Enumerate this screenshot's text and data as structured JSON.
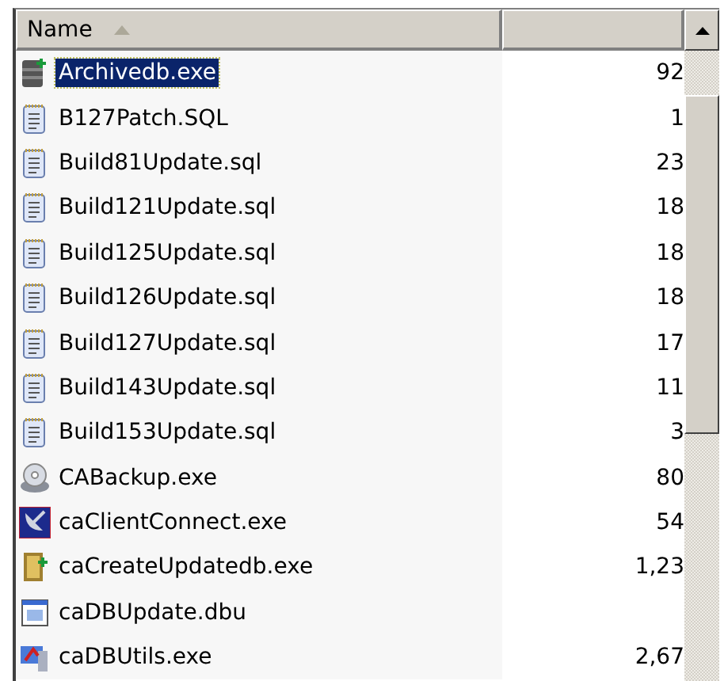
{
  "columns": [
    {
      "label": "Name",
      "sort_ascending": true
    },
    {}
  ],
  "rows": [
    {
      "name": "Archivedb.exe",
      "size": "92",
      "kind": "database",
      "selected": true
    },
    {
      "name": "B127Patch.SQL",
      "size": "1",
      "kind": "notepad",
      "selected": false
    },
    {
      "name": "Build81Update.sql",
      "size": "23",
      "kind": "notepad",
      "selected": false
    },
    {
      "name": "Build121Update.sql",
      "size": "18",
      "kind": "notepad",
      "selected": false
    },
    {
      "name": "Build125Update.sql",
      "size": "18",
      "kind": "notepad",
      "selected": false
    },
    {
      "name": "Build126Update.sql",
      "size": "18",
      "kind": "notepad",
      "selected": false
    },
    {
      "name": "Build127Update.sql",
      "size": "17",
      "kind": "notepad",
      "selected": false
    },
    {
      "name": "Build143Update.sql",
      "size": "11",
      "kind": "notepad",
      "selected": false
    },
    {
      "name": "Build153Update.sql",
      "size": "3",
      "kind": "notepad",
      "selected": false
    },
    {
      "name": "CABackup.exe",
      "size": "80",
      "kind": "backup",
      "selected": false
    },
    {
      "name": "caClientConnect.exe",
      "size": "54",
      "kind": "satellite",
      "selected": false
    },
    {
      "name": "caCreateUpdatedb.exe",
      "size": "1,23",
      "kind": "dbcreate",
      "selected": false
    },
    {
      "name": "caDBUpdate.dbu",
      "kind": "window",
      "selected": false
    },
    {
      "name": "caDBUtils.exe",
      "size": "2,67",
      "kind": "utils",
      "selected": false
    }
  ]
}
